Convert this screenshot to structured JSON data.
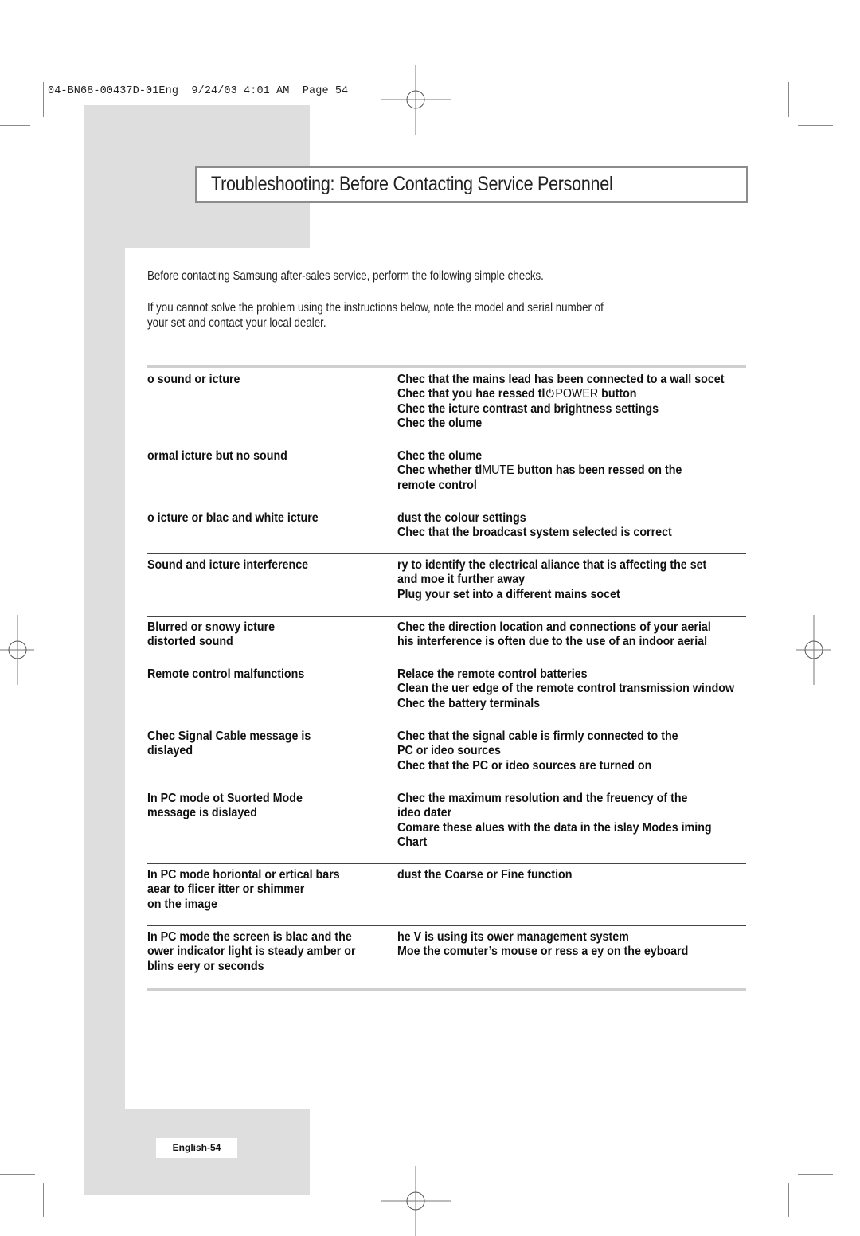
{
  "slug": {
    "text": "04-BN68-00437D-01Eng  9/24/03 4:01 AM  Page 54"
  },
  "header": {
    "title": "Troubleshooting: Before Contacting Service Personnel"
  },
  "intro": {
    "line1": "Before contacting Samsung after-sales service, perform the following simple checks.",
    "line2a": "If you cannot solve the problem using the instructions below, note the model and serial number of",
    "line2b": "your set and contact your local dealer."
  },
  "troubleshooting": {
    "rows": [
      {
        "problem": [
          "o sound or icture"
        ],
        "solution": [
          "Chec that the mains lead has been connected to a wall socet",
          {
            "pre": "Chec that you hae ressed tl",
            "icon": "power-icon",
            "thin": "POWER",
            "post": " button"
          },
          "Chec the icture contrast and brightness settings",
          "Chec the olume"
        ]
      },
      {
        "problem": [
          "ormal icture but no sound"
        ],
        "solution": [
          "Chec the olume",
          {
            "pre": "Chec whether tl",
            "thin": "MUTE",
            "post": " button has been ressed on the"
          },
          "remote control"
        ]
      },
      {
        "problem": [
          "o icture or blac and white icture"
        ],
        "solution": [
          "dust the colour settings",
          "Chec that the broadcast system selected is correct"
        ]
      },
      {
        "problem": [
          "Sound and icture interference"
        ],
        "solution": [
          "ry to identify the electrical aliance that is affecting the set",
          "and moe it further away",
          "Plug your set into a different mains socet"
        ]
      },
      {
        "problem": [
          "Blurred or snowy icture",
          "distorted sound"
        ],
        "solution": [
          "Chec the direction location and connections of your aerial",
          "his interference is often due to the use of an indoor aerial"
        ]
      },
      {
        "problem": [
          "Remote control malfunctions"
        ],
        "solution": [
          "Relace the remote control batteries",
          "Clean the uer edge of the remote control transmission window",
          "Chec the battery terminals"
        ]
      },
      {
        "problem": [
          "Chec Signal Cable message is",
          "dislayed"
        ],
        "solution": [
          "Chec that the signal cable is firmly connected to the",
          "PC or ideo sources",
          "Chec that the PC or ideo sources are turned on"
        ]
      },
      {
        "problem": [
          "In PC mode ot Suorted Mode",
          "message is dislayed"
        ],
        "solution": [
          "Chec the maximum resolution and the freuency of the",
          "ideo dater",
          "Comare these alues with the data in the islay Modes iming",
          "Chart"
        ]
      },
      {
        "problem": [
          "In PC mode horiontal or ertical bars",
          "aear to flicer itter or shimmer",
          "on the image"
        ],
        "solution": [
          "dust the Coarse or Fine function"
        ]
      },
      {
        "problem": [
          "In PC mode the screen is blac and the",
          "ower indicator light is steady amber or",
          "blins eery  or  seconds"
        ],
        "solution": [
          "he V is using its ower management system",
          "Moe the comuter’s mouse or ress a ey on the eyboard"
        ]
      }
    ]
  },
  "footer": {
    "page_label": "English-54"
  }
}
